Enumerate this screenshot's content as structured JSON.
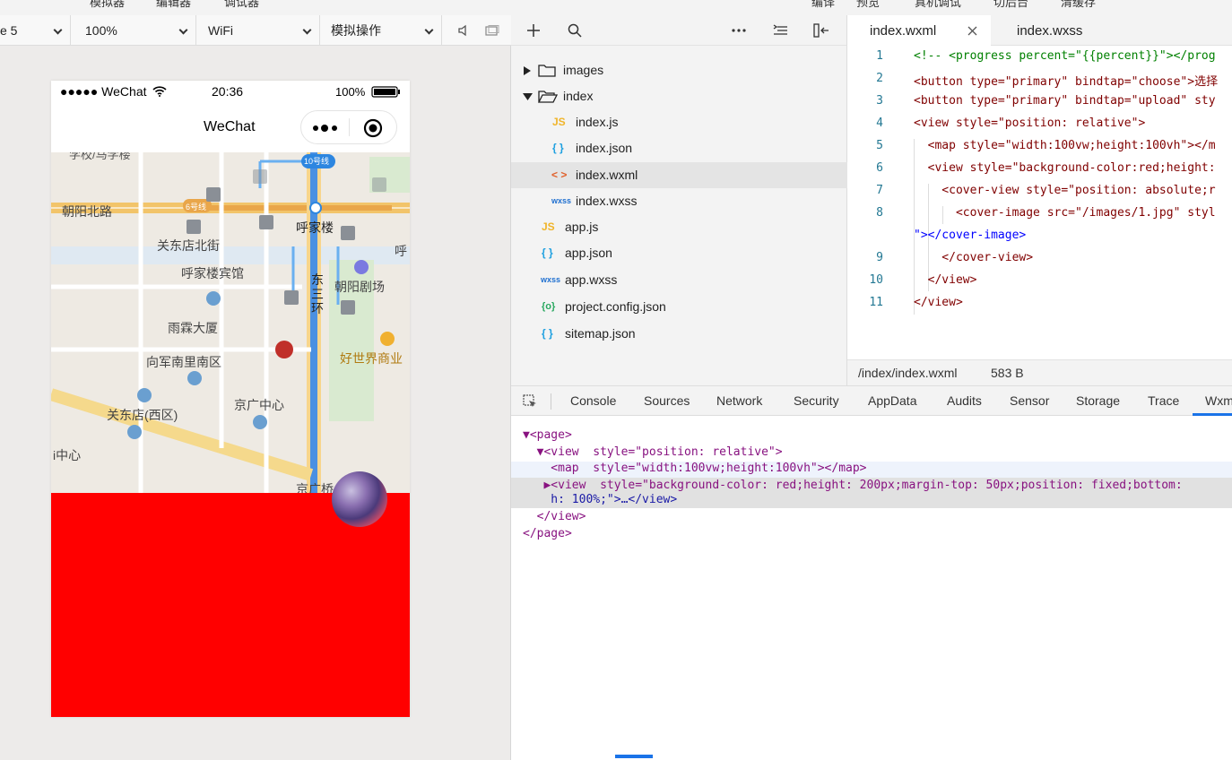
{
  "top_menu": [
    "模拟器",
    "编辑器",
    "调试器",
    "编译",
    "预览",
    "真机调试",
    "切后台",
    "清缓存"
  ],
  "simulator_toolbar": {
    "device": "e 5",
    "zoom": "100%",
    "network": "WiFi",
    "operation": "模拟操作"
  },
  "phone": {
    "carrier": "●●●●● WeChat",
    "time": "20:36",
    "battery": "100%",
    "nav_title": "WeChat",
    "map_labels": [
      "学校/马学楼",
      "10号线",
      "6号线",
      "朝阳北路",
      "关东店北街",
      "呼家楼",
      "呼家楼宾馆",
      "东三环",
      "朝阳剧场",
      "雨霖大厦",
      "好世界商业",
      "向军南里南区",
      "关东店(西区)",
      "京广中心",
      "i中心",
      "京广桥",
      "呼"
    ]
  },
  "explorer": {
    "items": [
      {
        "label": "images",
        "icon": "folder-icon",
        "type": "folder"
      },
      {
        "label": "index",
        "icon": "folder-open-icon",
        "type": "folder"
      },
      {
        "label": "index.js",
        "icon": "JS"
      },
      {
        "label": "index.json",
        "icon": "{ }"
      },
      {
        "label": "index.wxml",
        "icon": "< >"
      },
      {
        "label": "index.wxss",
        "icon": "wxss"
      },
      {
        "label": "app.js",
        "icon": "JS"
      },
      {
        "label": "app.json",
        "icon": "{ }"
      },
      {
        "label": "app.wxss",
        "icon": "wxss"
      },
      {
        "label": "project.config.json",
        "icon": "{o}"
      },
      {
        "label": "sitemap.json",
        "icon": "{ }"
      }
    ]
  },
  "editor": {
    "tabs": [
      "index.wxml",
      "index.wxss"
    ],
    "line_numbers": [
      "1",
      "2",
      "3",
      "4",
      "5",
      "6",
      "7",
      "8",
      "",
      "9",
      "10",
      "11"
    ],
    "lines": [
      "<!-- <progress percent=\"{{percent}}\"></prog",
      "<button type=\"primary\" bindtap=\"choose\">选择",
      "<button type=\"primary\" bindtap=\"upload\" sty",
      "<view style=\"position: relative\">",
      "  <map style=\"width:100vw;height:100vh\"></m",
      "  <view style=\"background-color:red;height:",
      "    <cover-view style=\"position: absolute;r",
      "      <cover-image src=\"/images/1.jpg\" styl",
      "\"></cover-image>",
      "    </cover-view>",
      "  </view>",
      "</view>"
    ],
    "file_path": "/index/index.wxml",
    "file_size": "583 B"
  },
  "devtools": {
    "tabs": [
      "Console",
      "Sources",
      "Network",
      "Security",
      "AppData",
      "Audits",
      "Sensor",
      "Storage",
      "Trace",
      "Wxm"
    ],
    "dom_lines": [
      "▼<page>",
      "  ▼<view  style=\"position: relative\">",
      "    <map  style=\"width:100vw;height:100vh\"></map>",
      "   ▶<view  style=\"background-color: red;height: 200px;margin-top: 50px;position: fixed;bottom:",
      "    h: 100%;\">…</view>",
      "  </view>",
      "</page>"
    ]
  }
}
